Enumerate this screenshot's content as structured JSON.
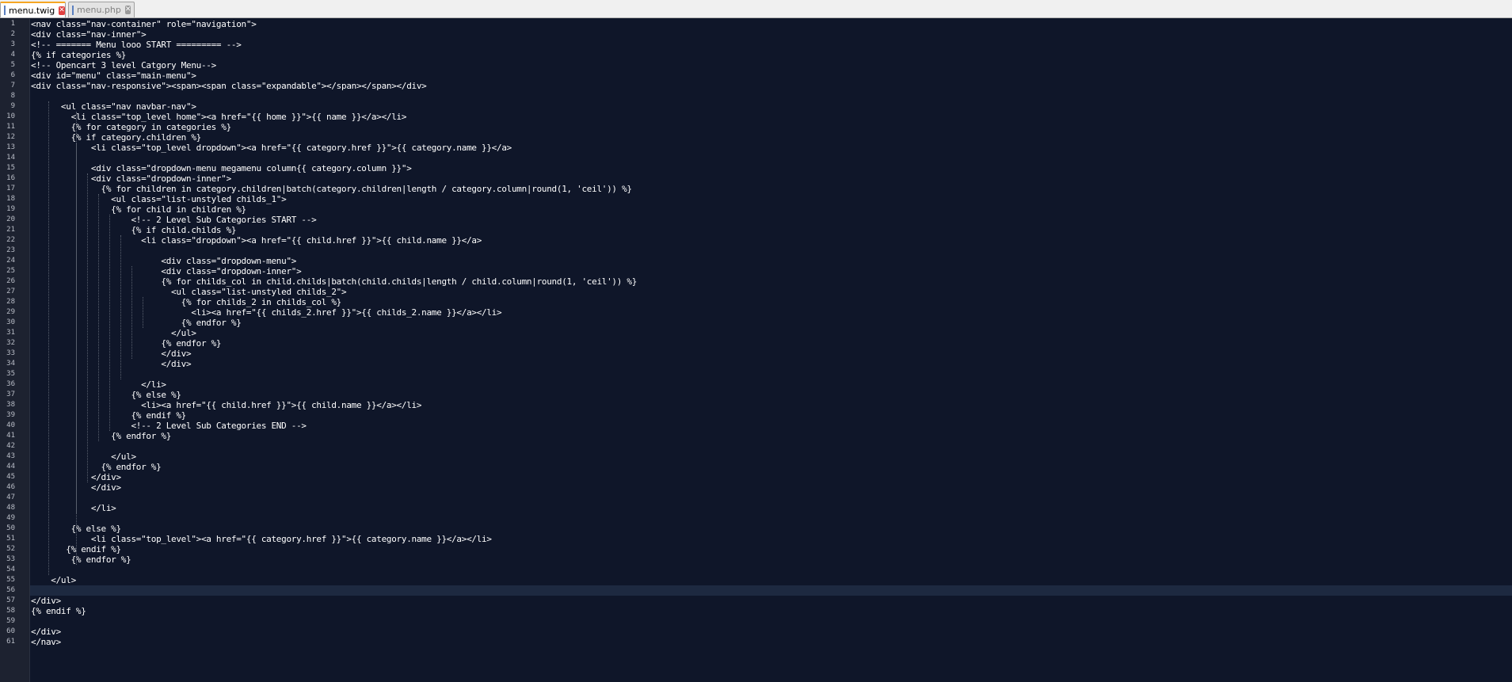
{
  "tabs": [
    {
      "label": "menu.twig",
      "active": true
    },
    {
      "label": "menu.php",
      "active": false
    }
  ],
  "colors": {
    "background": "#0f1629",
    "text": "#ffffff",
    "gutter": "#1d2230",
    "current_line": "#1d2940"
  },
  "editor": {
    "current_line": 56,
    "lines": [
      "<nav class=\"nav-container\" role=\"navigation\">",
      "<div class=\"nav-inner\">",
      "<!-- ======= Menu looo START ========= -->",
      "{% if categories %}",
      "<!-- Opencart 3 level Catgory Menu-->",
      "<div id=\"menu\" class=\"main-menu\">",
      "<div class=\"nav-responsive\"><span><span class=\"expandable\"></span></span></div>",
      "",
      "      <ul class=\"nav navbar-nav\">",
      "        <li class=\"top_level home\"><a href=\"{{ home }}\">{{ name }}</a></li>",
      "        {% for category in categories %}",
      "        {% if category.children %}",
      "            <li class=\"top_level dropdown\"><a href=\"{{ category.href }}\">{{ category.name }}</a>",
      "",
      "            <div class=\"dropdown-menu megamenu column{{ category.column }}\">",
      "            <div class=\"dropdown-inner\">",
      "              {% for children in category.children|batch(category.children|length / category.column|round(1, 'ceil')) %}",
      "                <ul class=\"list-unstyled childs_1\">",
      "                {% for child in children %}",
      "                    <!-- 2 Level Sub Categories START -->",
      "                    {% if child.childs %}",
      "                      <li class=\"dropdown\"><a href=\"{{ child.href }}\">{{ child.name }}</a>",
      "",
      "                          <div class=\"dropdown-menu\">",
      "                          <div class=\"dropdown-inner\">",
      "                          {% for childs_col in child.childs|batch(child.childs|length / child.column|round(1, 'ceil')) %}",
      "                            <ul class=\"list-unstyled childs_2\">",
      "                              {% for childs_2 in childs_col %}",
      "                                <li><a href=\"{{ childs_2.href }}\">{{ childs_2.name }}</a></li>",
      "                              {% endfor %}",
      "                            </ul>",
      "                          {% endfor %}",
      "                          </div>",
      "                          </div>",
      "",
      "                      </li>",
      "                    {% else %}",
      "                      <li><a href=\"{{ child.href }}\">{{ child.name }}</a></li>",
      "                    {% endif %}",
      "                    <!-- 2 Level Sub Categories END -->",
      "                {% endfor %}",
      "",
      "                </ul>",
      "              {% endfor %}",
      "            </div>",
      "            </div>",
      "",
      "            </li>",
      "",
      "        {% else %}",
      "            <li class=\"top_level\"><a href=\"{{ category.href }}\">{{ category.name }}</a></li>",
      "       {% endif %}",
      "        {% endfor %}",
      "",
      "    </ul>",
      "",
      "</div>",
      "{% endif %}",
      "",
      "</div>",
      "</nav>"
    ]
  }
}
